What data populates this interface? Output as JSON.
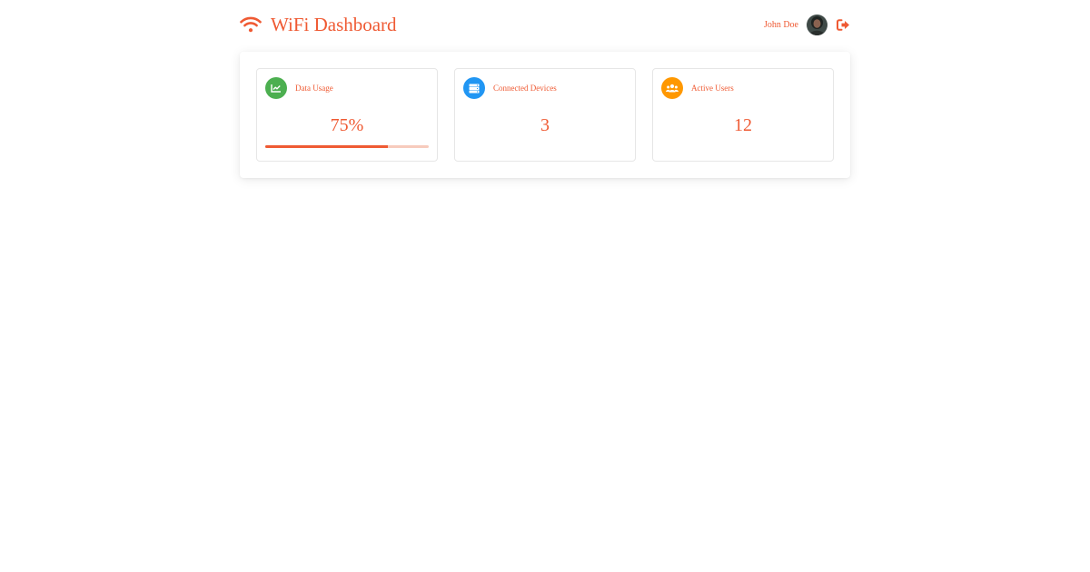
{
  "app": {
    "title": "WiFi Dashboard",
    "icon": "wifi-icon",
    "accent_color": "#ef5a33"
  },
  "user": {
    "name": "John Doe",
    "avatar_icon": "avatar",
    "logout_icon": "sign-out-icon"
  },
  "cards": [
    {
      "label": "Data Usage",
      "value": "75%",
      "icon": "chart-line-icon",
      "icon_color": "#4caf50",
      "progress": 0.75
    },
    {
      "label": "Connected Devices",
      "value": "3",
      "icon": "server-icon",
      "icon_color": "#2196f3"
    },
    {
      "label": "Active Users",
      "value": "12",
      "icon": "users-icon",
      "icon_color": "#ff9800"
    }
  ]
}
